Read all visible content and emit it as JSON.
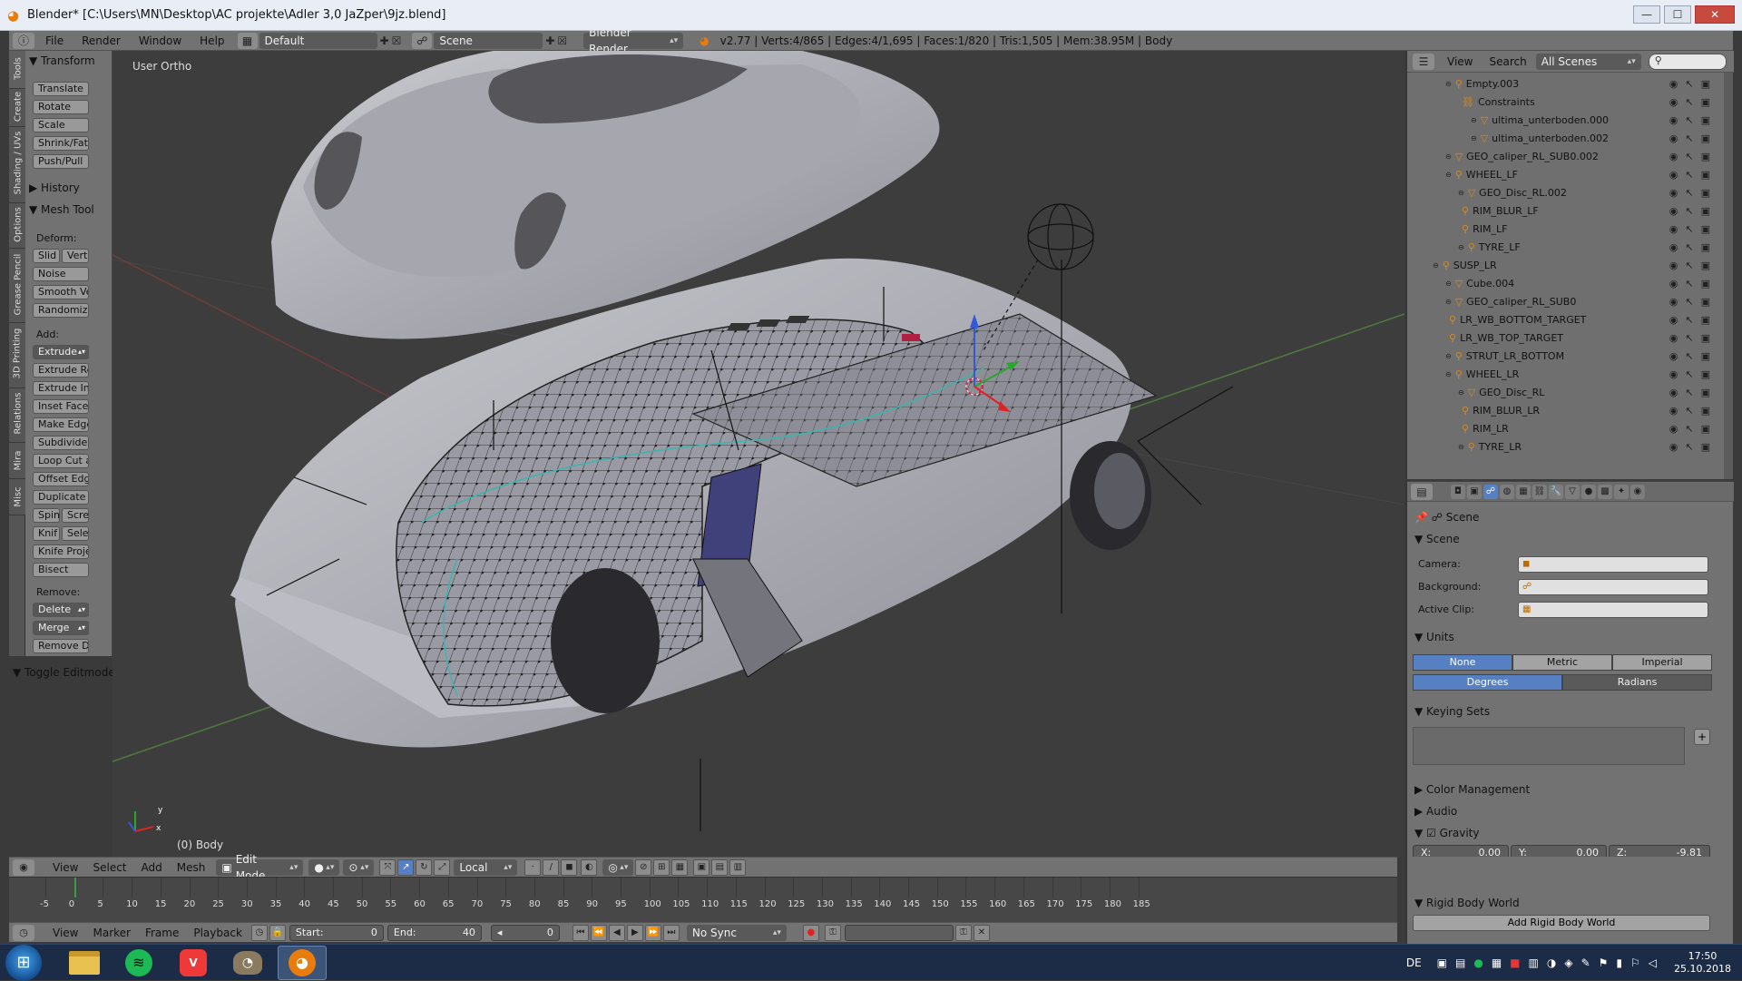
{
  "window": {
    "title": "Blender* [C:\\Users\\MN\\Desktop\\AC projekte\\Adler 3,0 JaZper\\9jz.blend]",
    "buttons": {
      "minimize": "—",
      "maximize": "☐",
      "close": "✕"
    }
  },
  "info_header": {
    "menus": [
      "File",
      "Render",
      "Window",
      "Help"
    ],
    "layout": "Default",
    "scene": "Scene",
    "engine": "Blender Render",
    "stats": "v2.77 | Verts:4/865 | Edges:4/1,695 | Faces:1/820 | Tris:1,505 | Mem:38.95M | Body"
  },
  "tool_tabs": [
    "Tools",
    "Create",
    "Shading / UVs",
    "Options",
    "Grease Pencil",
    "3D Printing",
    "Relations",
    "Mira",
    "Misc"
  ],
  "tool_shelf": {
    "transform_header": "Transform",
    "transform": [
      "Translate",
      "Rotate",
      "Scale",
      "Shrink/Fatt",
      "Push/Pull"
    ],
    "history_header": "History",
    "mesh_tools_header": "Mesh Tool",
    "deform_label": "Deform:",
    "deform_pair": [
      "Slid",
      "Vert"
    ],
    "deform": [
      "Noise",
      "Smooth Ve",
      "Randomize"
    ],
    "add_label": "Add:",
    "add": [
      "Extrude",
      "Extrude Re",
      "Extrude In",
      "Inset Face",
      "Make Edge",
      "Subdivide",
      "Loop Cut a",
      "Offset Edg",
      "Duplicate"
    ],
    "add_pair1": [
      "Spin",
      "Scre"
    ],
    "add_pair2": [
      "Knif",
      "Sele"
    ],
    "add2": [
      "Knife Proje",
      "Bisect"
    ],
    "remove_label": "Remove:",
    "remove": [
      "Delete",
      "Merge",
      "Remove D"
    ],
    "toggle": "Toggle Editmode"
  },
  "viewport": {
    "view_label": "User Ortho",
    "object_label": "(0) Body",
    "axis_y": "y",
    "axis_x": "x"
  },
  "outliner": {
    "menus": [
      "View",
      "Search"
    ],
    "filter": "All Scenes",
    "rows": [
      {
        "name": "Empty.003"
      },
      {
        "name": "Constraints"
      },
      {
        "name": "ultima_unterboden.000"
      },
      {
        "name": "ultima_unterboden.002"
      },
      {
        "name": "GEO_caliper_RL_SUB0.002"
      },
      {
        "name": "WHEEL_LF"
      },
      {
        "name": "GEO_Disc_RL.002"
      },
      {
        "name": "RIM_BLUR_LF"
      },
      {
        "name": "RIM_LF"
      },
      {
        "name": "TYRE_LF"
      },
      {
        "name": "SUSP_LR"
      },
      {
        "name": "Cube.004"
      },
      {
        "name": "GEO_caliper_RL_SUB0"
      },
      {
        "name": "LR_WB_BOTTOM_TARGET"
      },
      {
        "name": "LR_WB_TOP_TARGET"
      },
      {
        "name": "STRUT_LR_BOTTOM"
      },
      {
        "name": "WHEEL_LR"
      },
      {
        "name": "GEO_Disc_RL"
      },
      {
        "name": "RIM_BLUR_LR"
      },
      {
        "name": "RIM_LR"
      },
      {
        "name": "TYRE_LR"
      }
    ]
  },
  "properties": {
    "context": "Scene",
    "scene_header": "Scene",
    "camera_label": "Camera:",
    "background_label": "Background:",
    "active_clip_label": "Active Clip:",
    "units_header": "Units",
    "units": [
      "None",
      "Metric",
      "Imperial"
    ],
    "rotation": [
      "Degrees",
      "Radians"
    ],
    "keying_header": "Keying Sets",
    "color_mgmt": "Color Management",
    "audio": "Audio",
    "gravity": "Gravity",
    "gravity_x_label": "X:",
    "gravity_x": "0.00",
    "gravity_y_label": "Y:",
    "gravity_y": "0.00",
    "gravity_z_label": "Z:",
    "gravity_z": "-9.81",
    "rigid_header": "Rigid Body World",
    "rigid_button": "Add Rigid Body World"
  },
  "view3d_header": {
    "menus": [
      "View",
      "Select",
      "Add",
      "Mesh"
    ],
    "mode": "Edit Mode",
    "orientation": "Local"
  },
  "timeline": {
    "ticks": [
      "-5",
      "0",
      "5",
      "10",
      "15",
      "20",
      "25",
      "30",
      "35",
      "40",
      "45",
      "50",
      "55",
      "60",
      "65",
      "70",
      "75",
      "80",
      "85",
      "90",
      "95",
      "100",
      "105",
      "110",
      "115",
      "120",
      "125",
      "130",
      "135",
      "140",
      "145",
      "150",
      "155",
      "160",
      "165",
      "170",
      "175",
      "180",
      "185"
    ],
    "current_frame_marker": 0
  },
  "timeline_header": {
    "menus": [
      "View",
      "Marker",
      "Frame",
      "Playback"
    ],
    "start_label": "Start:",
    "start": "0",
    "end_label": "End:",
    "end": "40",
    "current": "0",
    "sync": "No Sync"
  },
  "taskbar": {
    "lang": "DE",
    "time": "17:50",
    "date": "25.10.2018"
  }
}
